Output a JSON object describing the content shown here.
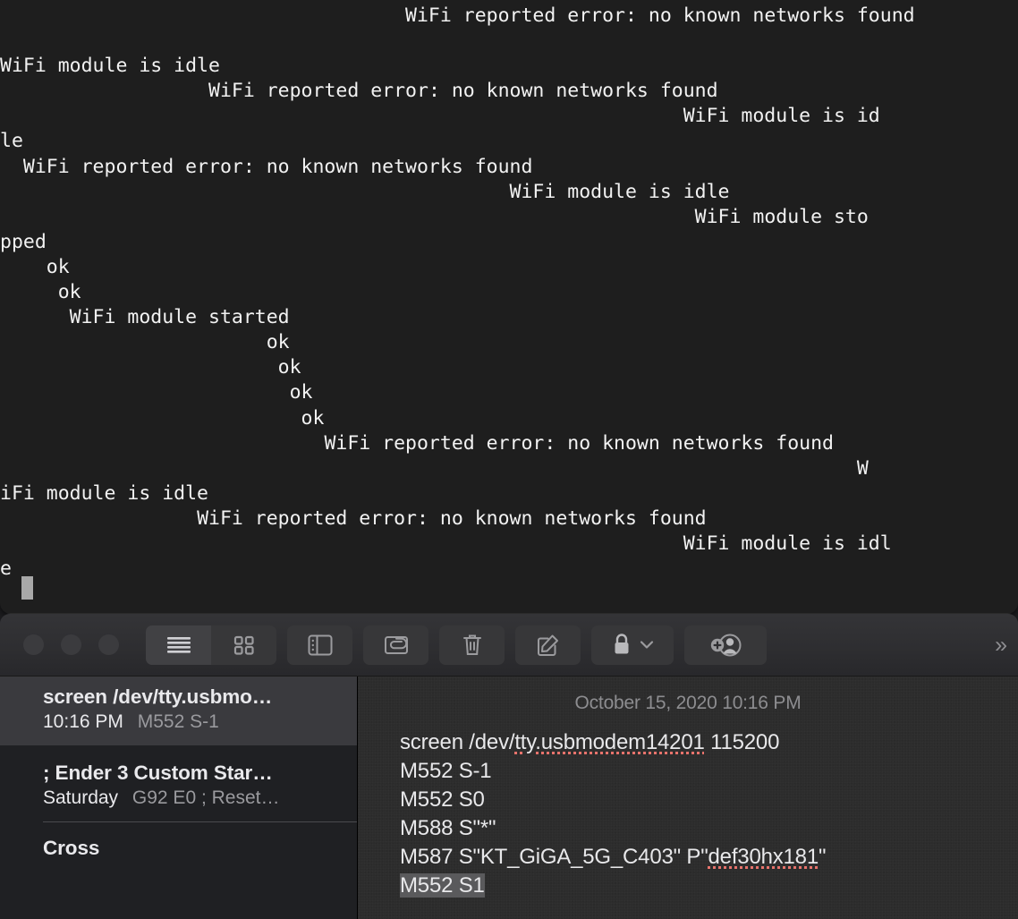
{
  "terminal": {
    "name": "screen-serial-session",
    "lines": [
      "                                   WiFi reported error: no known networks found",
      "",
      "WiFi module is idle",
      "                  WiFi reported error: no known networks found",
      "                                                           WiFi module is id",
      "le",
      "  WiFi reported error: no known networks found",
      "                                            WiFi module is idle",
      "                                                            WiFi module sto",
      "pped",
      "    ok",
      "     ok",
      "      WiFi module started",
      "                       ok",
      "                        ok",
      "                         ok",
      "                          ok",
      "                            WiFi reported error: no known networks found",
      "                                                                          W",
      "iFi module is idle",
      "                 WiFi reported error: no known networks found",
      "                                                           WiFi module is idl",
      "e"
    ],
    "cursor": "block-cursor"
  },
  "notes": {
    "window_title": "Notes",
    "traffic_lights": [
      "close",
      "minimize",
      "zoom"
    ],
    "toolbar": {
      "view_list_label": "List View",
      "view_gallery_label": "Gallery View",
      "sidebar_label": "Show Folders",
      "attachments_label": "Attachments Browser",
      "delete_label": "Delete Note",
      "compose_label": "New Note",
      "lock_label": "Lock Note",
      "lock_menu_label": "Lock Options",
      "share_label": "Add People",
      "overflow_label": "More Toolbar Items",
      "overflow_glyph": "»"
    },
    "list": [
      {
        "title": "screen /dev/tty.usbmo…",
        "date": "10:16 PM",
        "snippet": "M552 S-1",
        "selected": true
      },
      {
        "title": "; Ender 3 Custom Star…",
        "date": "Saturday",
        "snippet": "G92 E0 ; Reset…",
        "selected": false
      },
      {
        "title": "Cross",
        "date": "",
        "snippet": "",
        "selected": false
      }
    ],
    "note": {
      "timestamp": "October 15, 2020 10:16 PM",
      "lines": [
        {
          "before": "screen /dev/",
          "spell": "tty.usbmodem14201",
          "after": " 115200",
          "selected": false
        },
        {
          "before": "M552 S-1",
          "spell": "",
          "after": "",
          "selected": false
        },
        {
          "before": "M552 S0",
          "spell": "",
          "after": "",
          "selected": false
        },
        {
          "before": "M588 S\"*\"",
          "spell": "",
          "after": "",
          "selected": false
        },
        {
          "before": "M587 S\"KT_GiGA_5G_C403\" P\"",
          "spell": "def30hx181",
          "after": "\"",
          "selected": false
        },
        {
          "before": "M552 S1",
          "spell": "",
          "after": "",
          "selected": true
        }
      ]
    }
  },
  "colors": {
    "terminal_bg": "#1e1e1e",
    "terminal_fg": "#f2f2f2",
    "notes_bg": "#2c2c2c",
    "list_bg": "#1f2023",
    "selected_row": "#3a3a3e",
    "spell_underline": "#e8736c",
    "text_selection": "#5a5a5c"
  }
}
